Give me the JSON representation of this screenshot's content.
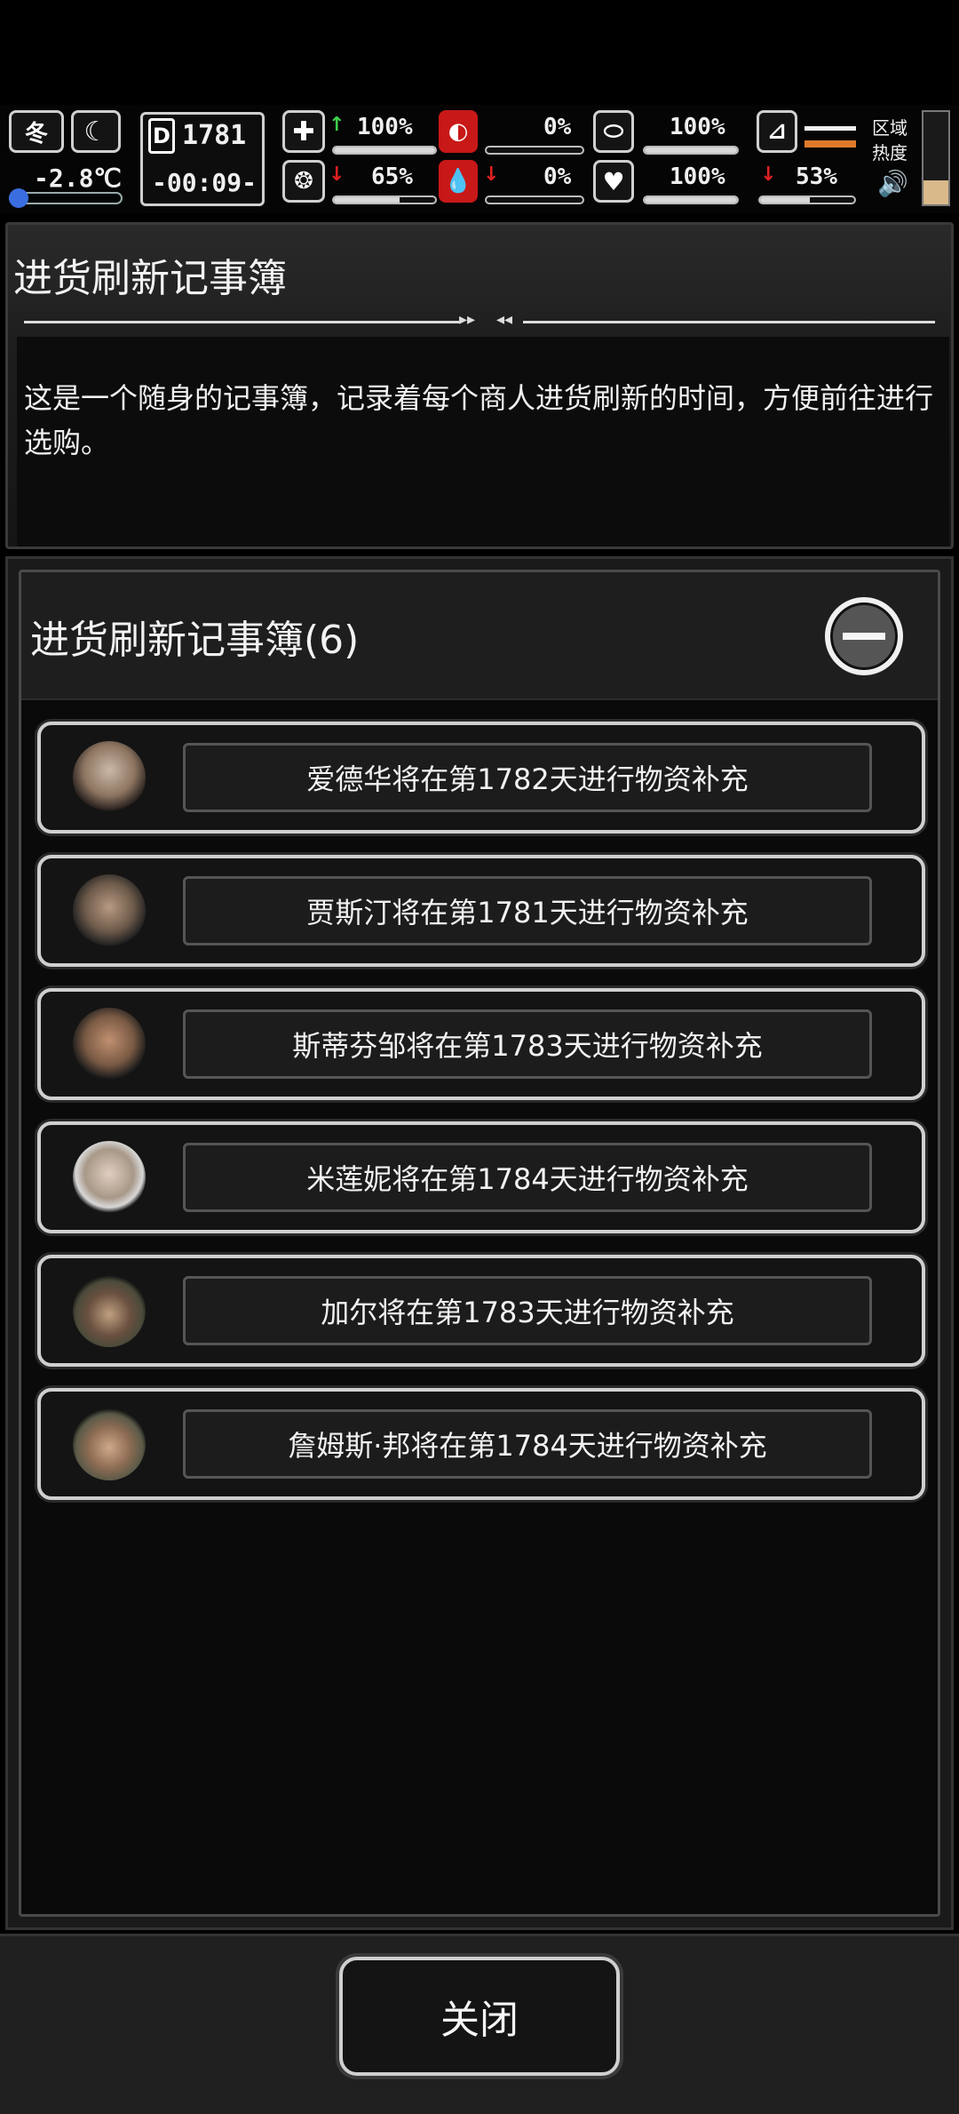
{
  "hud": {
    "season": "冬",
    "temperature": "-2.8℃",
    "day": "1781",
    "time": "-00:09-",
    "zone_heat_label_1": "区域",
    "zone_heat_label_2": "热度",
    "stats": [
      {
        "id": "health",
        "icon": "medkit-icon",
        "value": "100%",
        "trend": "up",
        "fill": 1.0
      },
      {
        "id": "mental",
        "icon": "brain-icon",
        "value": "65%",
        "trend": "down",
        "fill": 0.65
      },
      {
        "id": "hunger",
        "icon": "stomach-icon",
        "value": "0%",
        "trend": "none",
        "fill": 0.0
      },
      {
        "id": "thirst",
        "icon": "blood-drop-icon",
        "value": "0%",
        "trend": "down",
        "fill": 0.0
      },
      {
        "id": "stamina",
        "icon": "pill-icon",
        "value": "100%",
        "trend": "none",
        "fill": 1.0
      },
      {
        "id": "mood",
        "icon": "heart-icon",
        "value": "100%",
        "trend": "none",
        "fill": 1.0
      },
      {
        "id": "fatigue",
        "icon": "foot-icon",
        "value": "",
        "trend": "none",
        "fill": 0.0
      },
      {
        "id": "weight",
        "icon": "backpack-icon",
        "value": "53%",
        "trend": "down",
        "fill": 0.53
      }
    ],
    "colors": {
      "up": "#3ed04a",
      "down": "#e02020"
    }
  },
  "info": {
    "title": "进货刷新记事簿",
    "description": "这是一个随身的记事簿，记录着每个商人进货刷新的时间，方便前往进行选购。"
  },
  "list": {
    "title": "进货刷新记事簿(6)",
    "items": [
      {
        "text": "爱德华将在第1782天进行物资补充"
      },
      {
        "text": "贾斯汀将在第1781天进行物资补充"
      },
      {
        "text": "斯蒂芬邹将在第1783天进行物资补充"
      },
      {
        "text": "米莲妮将在第1784天进行物资补充"
      },
      {
        "text": "加尔将在第1783天进行物资补充"
      },
      {
        "text": "詹姆斯·邦将在第1784天进行物资补充"
      }
    ]
  },
  "footer": {
    "close_label": "关闭"
  }
}
